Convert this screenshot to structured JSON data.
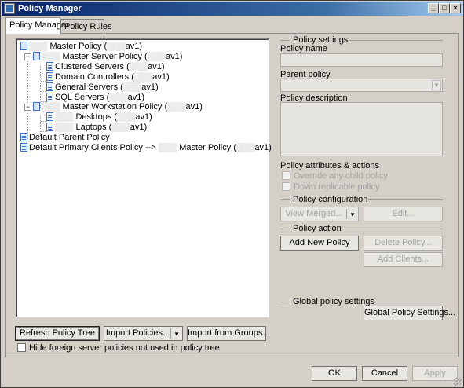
{
  "window": {
    "title": "Policy Manager",
    "controls": {
      "minimize": "_",
      "maximize": "□",
      "close": "×"
    }
  },
  "tabs": [
    {
      "label": "Policy Manager",
      "active": true
    },
    {
      "label": "Policy Rules",
      "active": false
    }
  ],
  "tree": {
    "nodes": [
      {
        "redacted": "▒▒▒",
        "label": "Master Policy (",
        "redacted2": "▒▒▒",
        "suffix": "av1)"
      },
      {
        "redacted": "▒▒▒",
        "label": "Master Server Policy (",
        "redacted2": "▒▒▒",
        "suffix": "av1)"
      },
      {
        "label": "Clustered Servers (",
        "redacted2": "▒▒▒",
        "suffix": "av1)"
      },
      {
        "label": "Domain Controllers (",
        "redacted2": "▒▒▒",
        "suffix": "av1)"
      },
      {
        "label": "General Servers (",
        "redacted2": "▒▒▒",
        "suffix": "av1)"
      },
      {
        "label": "SQL Servers (",
        "redacted2": "▒▒▒",
        "suffix": "av1)"
      },
      {
        "redacted": "▒▒▒",
        "label": "Master Workstation Policy (",
        "redacted2": "▒▒▒",
        "suffix": "av1)"
      },
      {
        "redacted": "▒▒▒",
        "label": "Desktops (",
        "redacted2": "▒▒▒",
        "suffix": "av1)"
      },
      {
        "redacted": "▒▒▒",
        "label": "Laptops (",
        "redacted2": "▒▒▒",
        "suffix": "av1)"
      },
      {
        "label": "Default Parent Policy"
      },
      {
        "label": "Default Primary Clients Policy  -->",
        "redacted": "▒▒▒",
        "label2": "Master Policy (",
        "redacted2": "▒▒▒",
        "suffix": "av1)"
      }
    ]
  },
  "left_buttons": {
    "refresh": "Refresh Policy Tree",
    "import_policies": "Import Policies...",
    "import_groups": "Import from Groups..."
  },
  "hide_foreign": "Hide foreign server policies not used in policy tree",
  "policy_settings": {
    "group_title": "Policy settings",
    "name_label": "Policy name",
    "name_value": "",
    "parent_label": "Parent policy",
    "parent_value": "",
    "description_label": "Policy description",
    "description_value": "",
    "attributes_label": "Policy attributes & actions",
    "override_label": "Override any child policy",
    "down_replicable_label": "Down replicable policy"
  },
  "policy_configuration": {
    "group_title": "Policy configuration",
    "view_merged": "View Merged...",
    "edit": "Edit..."
  },
  "policy_action": {
    "group_title": "Policy action",
    "add_new": "Add New Policy",
    "delete": "Delete Policy...",
    "add_clients": "Add Clients..."
  },
  "global_settings": {
    "group_title": "Global policy settings",
    "button": "Global Policy Settings..."
  },
  "dialog_buttons": {
    "ok": "OK",
    "cancel": "Cancel",
    "apply": "Apply"
  }
}
